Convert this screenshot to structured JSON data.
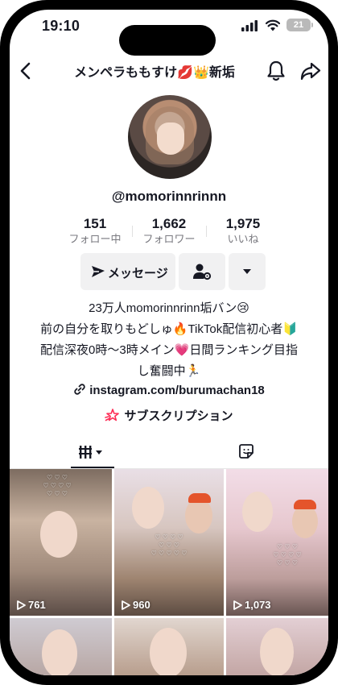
{
  "status_bar": {
    "time": "19:10",
    "battery": "21"
  },
  "header": {
    "title": "メンペラももすけ💋👑新垢"
  },
  "profile": {
    "username": "@momorinnrinnn",
    "stats": [
      {
        "value": "151",
        "label": "フォロー中"
      },
      {
        "value": "1,662",
        "label": "フォロワー"
      },
      {
        "value": "1,975",
        "label": "いいね"
      }
    ],
    "message_button": "メッセージ",
    "bio_lines": [
      "23万人momorinnrinn垢バン😢",
      "前の自分を取りもどしゅ🔥TikTok配信初心者🔰",
      "配信深夜0時〜3時メイン💗日間ランキング目指",
      "し奮闘中🏃"
    ],
    "link": "instagram.com/burumachan18",
    "subscription": "サブスクリプション"
  },
  "videos": [
    {
      "views": "761"
    },
    {
      "views": "960"
    },
    {
      "views": "1,073"
    },
    {
      "views": ""
    },
    {
      "views": ""
    },
    {
      "views": ""
    }
  ]
}
